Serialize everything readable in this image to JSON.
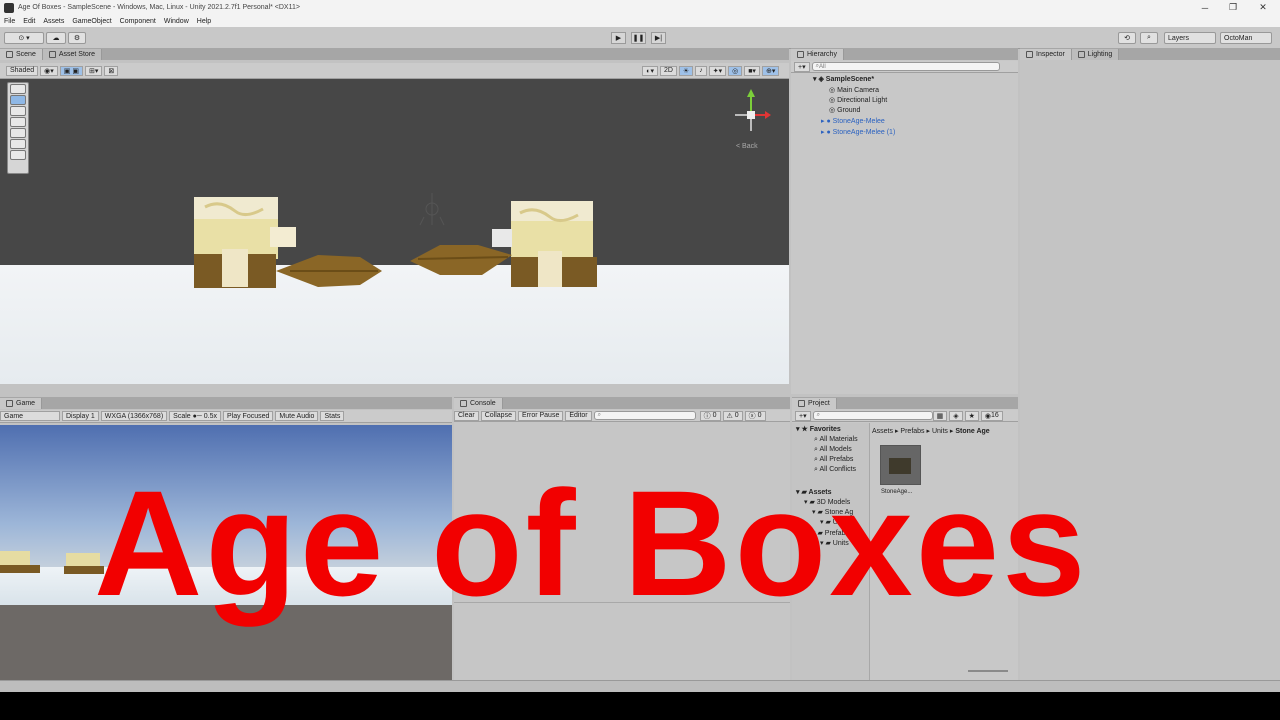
{
  "window": {
    "title": "Age Of Boxes - SampleScene - Windows, Mac, Linux - Unity 2021.2.7f1 Personal* <DX11>",
    "minimize": "─",
    "maximize": "❐",
    "close": "✕"
  },
  "menu": [
    "File",
    "Edit",
    "Assets",
    "GameObject",
    "Component",
    "Window",
    "Help"
  ],
  "toolbar": {
    "layers_label": "Layers",
    "layout_label": "OctoMan"
  },
  "scene": {
    "tabs": [
      "Scene",
      "Asset Store"
    ],
    "draw_mode": "Shaded",
    "view_2d": "2D",
    "gizmo_label": "< Back"
  },
  "game": {
    "tab": "Game",
    "mode": "Game",
    "display": "Display 1",
    "resolution": "WXGA (1366x768)",
    "scale_label": "Scale",
    "scale_value": "0.5x",
    "play_focused": "Play Focused",
    "mute_audio": "Mute Audio",
    "stats": "Stats"
  },
  "console": {
    "tab": "Console",
    "clear": "Clear",
    "collapse": "Collapse",
    "error_pause": "Error Pause",
    "editor": "Editor",
    "log_count": "0",
    "warn_count": "0",
    "error_count": "0"
  },
  "hierarchy": {
    "tab": "Hierarchy",
    "search_placeholder": "All",
    "scene_name": "SampleScene*",
    "items": [
      {
        "label": "Main Camera"
      },
      {
        "label": "Directional Light"
      },
      {
        "label": "Ground"
      },
      {
        "label": "StoneAge-Melee"
      },
      {
        "label": "StoneAge-Melee (1)"
      }
    ]
  },
  "inspector": {
    "tabs": [
      "Inspector",
      "Lighting"
    ]
  },
  "project": {
    "tab": "Project",
    "count": "16",
    "favorites_label": "Favorites",
    "favorites": [
      "All Materials",
      "All Models",
      "All Prefabs",
      "All Conflicts"
    ],
    "assets_label": "Assets",
    "tree": [
      "3D Models",
      "Stone Ag",
      "Units",
      "Prefabs",
      "Units"
    ],
    "breadcrumb": [
      "Assets",
      "Prefabs",
      "Units",
      "Stone Age"
    ],
    "asset_name": "StoneAge..."
  },
  "overlay_title": "Age of Boxes",
  "colors": {
    "overlay_red": "#f20000",
    "prefab_blue": "#2b62c0",
    "scene_bg": "#474747"
  }
}
